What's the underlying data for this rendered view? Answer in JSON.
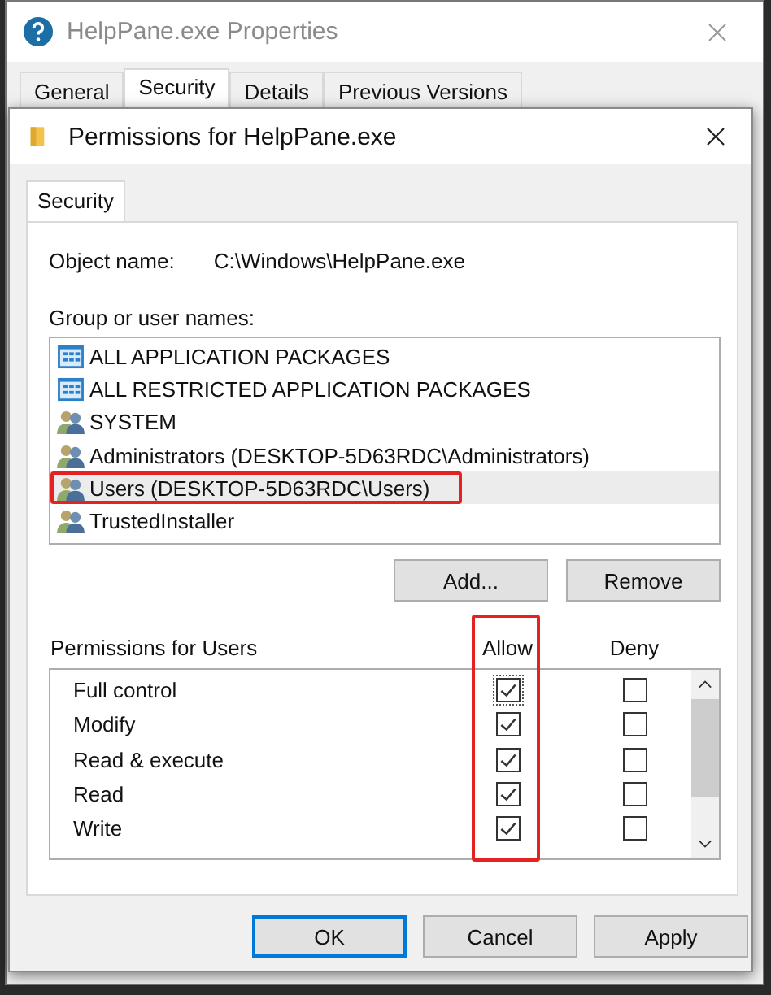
{
  "back_window": {
    "title": "HelpPane.exe Properties",
    "tabs": [
      {
        "label": "General",
        "selected": false
      },
      {
        "label": "Security",
        "selected": true
      },
      {
        "label": "Details",
        "selected": false
      },
      {
        "label": "Previous Versions",
        "selected": false
      }
    ]
  },
  "dialog": {
    "title": "Permissions for HelpPane.exe",
    "tab": "Security",
    "object_label": "Object name:",
    "object_value": "C:\\Windows\\HelpPane.exe",
    "group_label": "Group or user names:",
    "groups": [
      {
        "kind": "packages",
        "name": "ALL APPLICATION PACKAGES",
        "selected": false,
        "annotated": false
      },
      {
        "kind": "packages",
        "name": "ALL RESTRICTED APPLICATION PACKAGES",
        "selected": false,
        "annotated": false
      },
      {
        "kind": "users",
        "name": "SYSTEM",
        "selected": false,
        "annotated": false
      },
      {
        "kind": "users",
        "name": "Administrators (DESKTOP-5D63RDC\\Administrators)",
        "selected": false,
        "annotated": false
      },
      {
        "kind": "users",
        "name": "Users (DESKTOP-5D63RDC\\Users)",
        "selected": true,
        "annotated": true
      },
      {
        "kind": "users",
        "name": "TrustedInstaller",
        "selected": false,
        "annotated": false
      }
    ],
    "group_buttons": [
      "Add...",
      "Remove"
    ],
    "permissions_label": "Permissions for Users",
    "columns": [
      {
        "label": "Allow",
        "annotated": true
      },
      {
        "label": "Deny",
        "annotated": false
      }
    ],
    "permissions": [
      {
        "name": "Full control",
        "allow": true,
        "deny": false,
        "focused": true
      },
      {
        "name": "Modify",
        "allow": true,
        "deny": false,
        "focused": false
      },
      {
        "name": "Read & execute",
        "allow": true,
        "deny": false,
        "focused": false
      },
      {
        "name": "Read",
        "allow": true,
        "deny": false,
        "focused": false
      },
      {
        "name": "Write",
        "allow": true,
        "deny": false,
        "focused": false
      }
    ],
    "buttons": [
      {
        "label": "OK",
        "default": true
      },
      {
        "label": "Cancel",
        "default": false
      },
      {
        "label": "Apply",
        "default": false
      }
    ]
  }
}
